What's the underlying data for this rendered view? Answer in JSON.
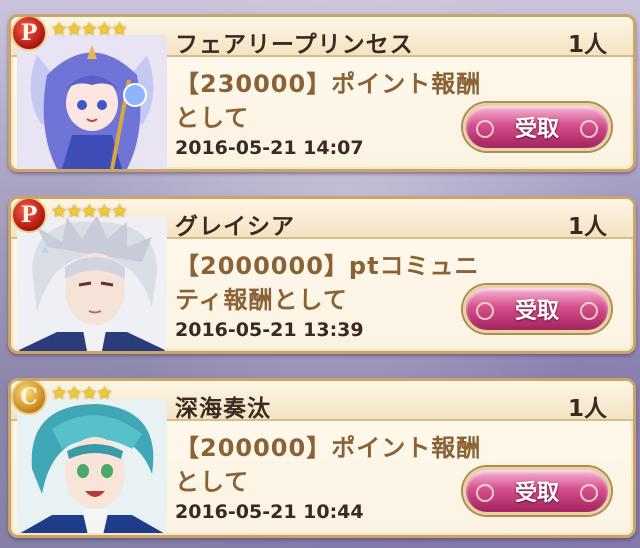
{
  "rewards": [
    {
      "rank": "P",
      "stars": "★★★★★",
      "name": "フェアリープリンセス",
      "count": "1人",
      "reward_text": "【230000】ポイント報酬として",
      "date": "2016-05-21 14:07",
      "claim_label": "受取",
      "portrait_icon": "fairy-princess-portrait"
    },
    {
      "rank": "P",
      "stars": "★★★★★",
      "name": "グレイシア",
      "count": "1人",
      "reward_text": "【2000000】ptコミュニティ報酬として",
      "date": "2016-05-21 13:39",
      "claim_label": "受取",
      "portrait_icon": "silver-haired-character-portrait"
    },
    {
      "rank": "C",
      "stars": "★★★★",
      "name": "深海奏汰",
      "count": "1人",
      "reward_text": "【200000】ポイント報酬として",
      "date": "2016-05-21 10:44",
      "claim_label": "受取",
      "portrait_icon": "teal-haired-character-portrait"
    }
  ],
  "colors": {
    "claim_button": "#d5508f",
    "reward_text": "#8a6236",
    "card_border": "#c9a56a",
    "rank_p": "#a2100c",
    "rank_c": "#c27a12"
  }
}
